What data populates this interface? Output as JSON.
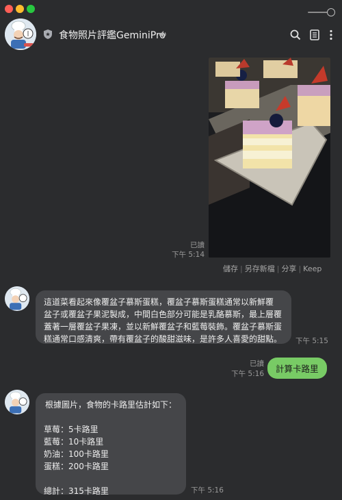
{
  "header": {
    "chat_title": "食物照片評鑑GeminiPro"
  },
  "photo": {
    "read_label": "已讀",
    "time": "下午 5:14"
  },
  "image_actions": [
    "儲存",
    "另存新檔",
    "分享",
    "Keep"
  ],
  "messages": {
    "bot_reply_1": {
      "lines": [
        "這道菜看起來像覆盆子慕斯蛋糕，覆盆子慕斯蛋糕通常以新鮮覆",
        "盆子或覆盆子果泥製成，中間白色部分可能是乳酪慕斯，最上層覆",
        "蓋著一層覆盆子果凍，並以新鮮覆盆子和藍莓裝飾。覆盆子慕斯蛋",
        "糕通常口感清爽，帶有覆盆子的酸甜滋味，是許多人喜愛的甜點。"
      ],
      "time": "下午 5:15"
    },
    "user_msg": {
      "text": "計算卡路里",
      "read_label": "已讀",
      "time": "下午 5:16"
    },
    "bot_reply_2": {
      "intro": "根據圖片，食物的卡路里估計如下：",
      "items": [
        "草莓：5卡路里",
        "藍莓：10卡路里",
        "奶油：100卡路里",
        "蛋糕：200卡路里"
      ],
      "total": "總計：315卡路里",
      "time": "下午 5:16"
    }
  },
  "icons": {
    "header_left": "shield-icon",
    "header_mute": "speaker-icon",
    "header_right": [
      "search-icon",
      "notes-icon",
      "more-icon"
    ]
  }
}
